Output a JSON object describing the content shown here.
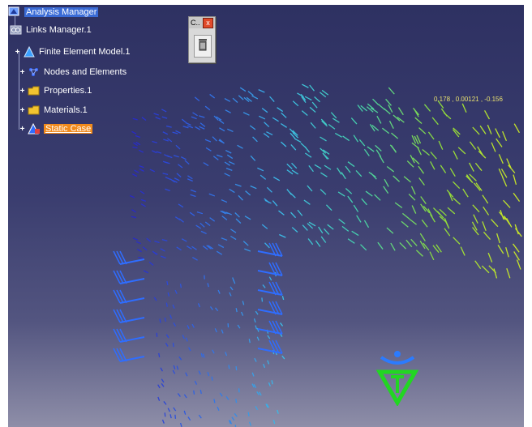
{
  "tree": {
    "root_label": "Analysis Manager",
    "items": [
      {
        "label": "Links Manager.1",
        "icon": "links-manager-icon"
      },
      {
        "label": "Finite Element Model.1",
        "icon": "finite-element-model-icon"
      },
      {
        "label": "Nodes and Elements",
        "icon": "nodes-elements-icon"
      },
      {
        "label": "Properties.1",
        "icon": "folder-icon"
      },
      {
        "label": "Materials.1",
        "icon": "folder-icon"
      },
      {
        "label": "Static Case",
        "icon": "static-case-icon",
        "selected": true
      }
    ]
  },
  "toolbar": {
    "title": "C..",
    "close_label": "x",
    "tool_icon": "delete-trash-icon"
  },
  "readout": {
    "text": "0.178 , 0.00121 , -0.156"
  },
  "colors": {
    "selected": "#f08a1c",
    "root_highlight": "#3a6bd6",
    "compass": "#22d622"
  }
}
